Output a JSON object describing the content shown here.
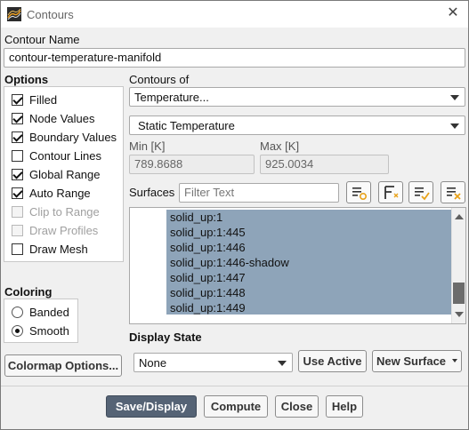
{
  "window": {
    "title": "Contours",
    "close_glyph": "✕"
  },
  "contour_name": {
    "label": "Contour Name",
    "value": "contour-temperature-manifold"
  },
  "options": {
    "label": "Options",
    "items": [
      {
        "label": "Filled",
        "checked": true,
        "enabled": true
      },
      {
        "label": "Node Values",
        "checked": true,
        "enabled": true
      },
      {
        "label": "Boundary Values",
        "checked": true,
        "enabled": true
      },
      {
        "label": "Contour Lines",
        "checked": false,
        "enabled": true
      },
      {
        "label": "Global Range",
        "checked": true,
        "enabled": true
      },
      {
        "label": "Auto Range",
        "checked": true,
        "enabled": true
      },
      {
        "label": "Clip to Range",
        "checked": false,
        "enabled": false
      },
      {
        "label": "Draw Profiles",
        "checked": false,
        "enabled": false
      },
      {
        "label": "Draw Mesh",
        "checked": false,
        "enabled": true
      }
    ]
  },
  "contours_of": {
    "label": "Contours of",
    "category": "Temperature...",
    "quantity": "Static Temperature"
  },
  "range": {
    "min_label": "Min [K]",
    "min_value": "789.8688",
    "max_label": "Max [K]",
    "max_value": "925.0034"
  },
  "surfaces": {
    "label": "Surfaces",
    "filter_placeholder": "Filter Text",
    "items": [
      "solid_up:1",
      "solid_up:1:445",
      "solid_up:1:446",
      "solid_up:1:446-shadow",
      "solid_up:1:447",
      "solid_up:1:448",
      "solid_up:1:449"
    ]
  },
  "coloring": {
    "label": "Coloring",
    "options": [
      {
        "label": "Banded",
        "selected": false
      },
      {
        "label": "Smooth",
        "selected": true
      }
    ]
  },
  "colormap_button": "Colormap Options...",
  "display_state": {
    "label": "Display State",
    "value": "None",
    "use_active": "Use Active",
    "new_surface": "New Surface"
  },
  "footer": {
    "save_display": "Save/Display",
    "compute": "Compute",
    "close": "Close",
    "help": "Help"
  },
  "colors": {
    "primary_button": "#556375",
    "selection": "#8ea4b9",
    "icon_accent": "#e8a21a"
  }
}
